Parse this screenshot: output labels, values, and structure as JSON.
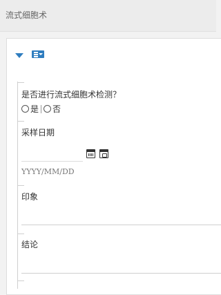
{
  "header": {
    "title": "流式细胞术"
  },
  "form": {
    "q1_label": "是否进行流式细胞术检测？",
    "q1_options": [
      "是",
      "否"
    ],
    "date_label": "采样日期",
    "date_placeholder": "YYYY/MM/DD",
    "impression_label": "印象",
    "conclusion_label": "结论"
  },
  "icons": {
    "collapse": "caret-down-icon",
    "menu": "list-menu-icon",
    "calendar": "calendar-icon",
    "calendar_clock": "calendar-clock-icon"
  },
  "colors": {
    "accent": "#2f7dbf",
    "background": "#f2f2f2",
    "card": "#ffffff"
  }
}
